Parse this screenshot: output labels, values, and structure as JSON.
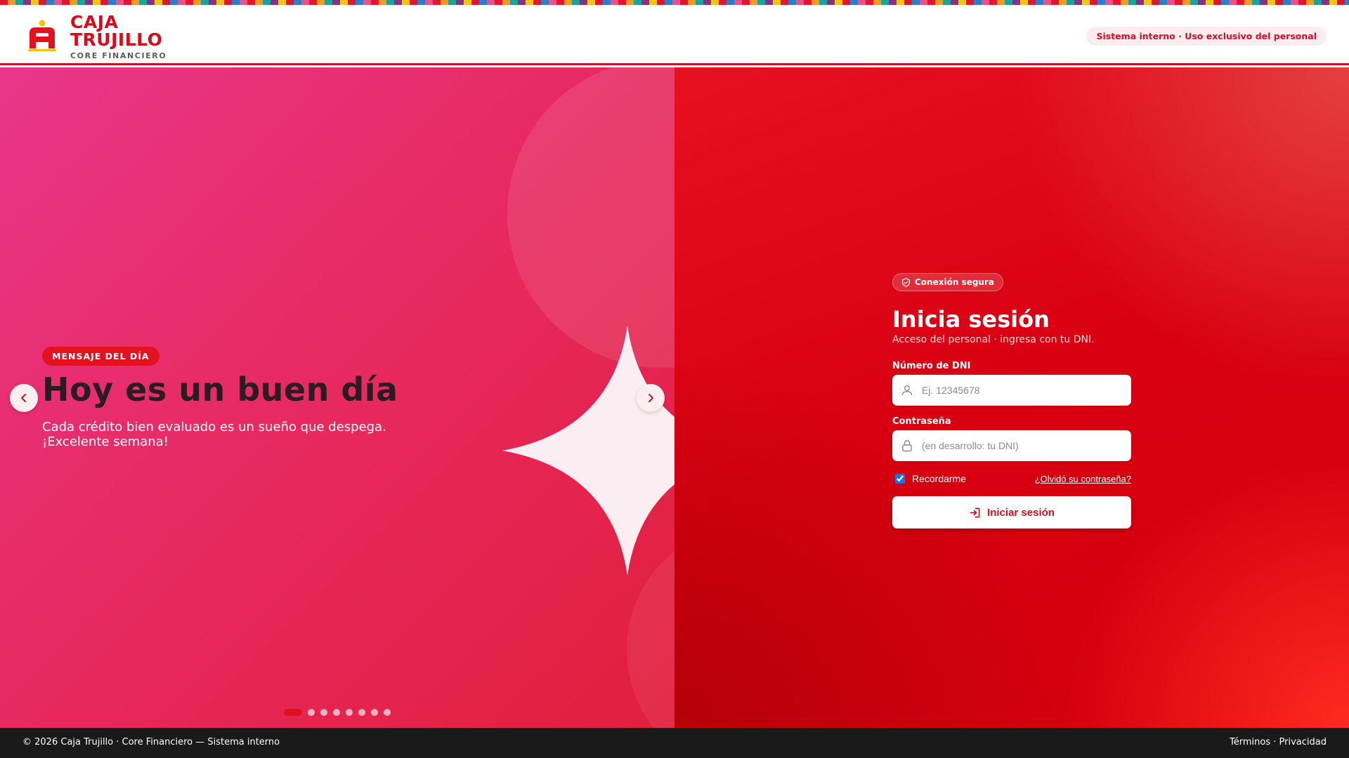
{
  "header": {
    "brand_line1": "CAJA",
    "brand_line2": "TRUJILLO",
    "brand_tagline": "CORE FINANCIERO",
    "badge": "Sistema interno · Uso exclusivo del personal"
  },
  "carousel": {
    "badge": "MENSAJE DEL DÍA",
    "title": "Hoy es un buen día",
    "text": "Cada crédito bien evaluado es un sueño que despega. ¡Excelente semana!",
    "slide_count": 8,
    "active_slide": 1
  },
  "login": {
    "secure_badge": "Conexión segura",
    "title": "Inicia sesión",
    "subtitle": "Acceso del personal · ingresa con tu DNI.",
    "dni_label": "Número de DNI",
    "dni_placeholder": "Ej. 12345678",
    "password_label": "Contraseña",
    "password_placeholder": "(en desarrollo: tu DNI)",
    "remember_label": "Recordarme",
    "remember_checked": true,
    "forgot_label": "¿Olvidó su contraseña?",
    "submit_label": "Iniciar sesión"
  },
  "footer": {
    "copyright": "© 2026 Caja Trujillo · Core Financiero — Sistema interno",
    "terms": "Términos",
    "separator": "·",
    "privacy": "Privacidad"
  },
  "colors": {
    "brand_red": "#d90a1a",
    "carousel_pink": "#e8368a",
    "panel_red": "#d80010",
    "footer_bg": "#1a1a1a"
  }
}
